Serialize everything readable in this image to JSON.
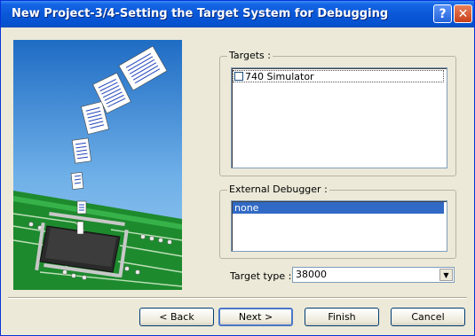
{
  "window": {
    "title": "New Project-3/4-Setting the Target System for Debugging"
  },
  "titlebar": {
    "help_glyph": "?",
    "close_glyph": "✕"
  },
  "targets": {
    "label": "Targets :",
    "items": [
      {
        "label": "740 Simulator",
        "checked": false
      }
    ]
  },
  "external_debugger": {
    "label": "External Debugger :",
    "items": [
      {
        "label": "none",
        "selected": true
      }
    ]
  },
  "target_type": {
    "label": "Target type :",
    "value": "38000"
  },
  "buttons": {
    "back": "< Back",
    "next": "Next >",
    "finish": "Finish",
    "cancel": "Cancel"
  },
  "colors": {
    "titlebar": "#0a58d8",
    "selection": "#316ac5",
    "dialog_bg": "#ece9d8"
  },
  "illustration": {
    "subject": "documents-flowing-into-chip"
  }
}
